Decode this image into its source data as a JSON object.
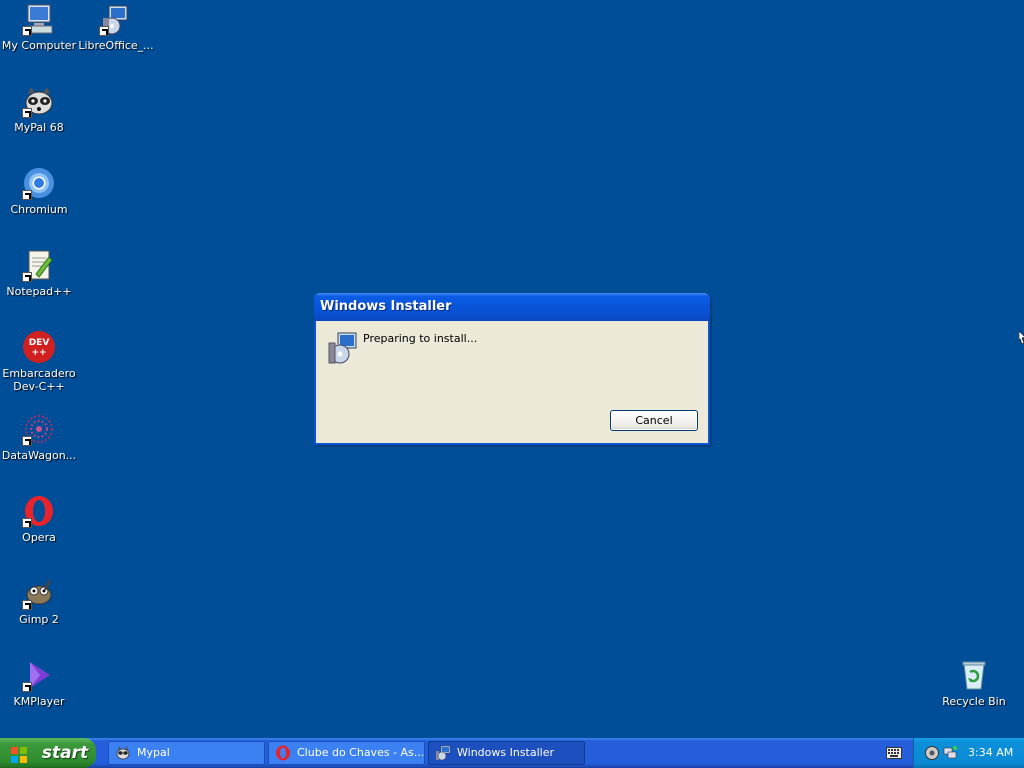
{
  "desktop": {
    "icons": [
      {
        "label": "My Computer",
        "icon": "computer-icon"
      },
      {
        "label": "LibreOffice_...",
        "icon": "installer-icon"
      },
      {
        "label": "MyPal 68",
        "icon": "raccoon-icon"
      },
      {
        "label": "Chromium",
        "icon": "chromium-icon"
      },
      {
        "label": "Notepad++",
        "icon": "notepad-icon"
      },
      {
        "label": "Embarcadero\nDev-C++",
        "icon": "devcpp-icon"
      },
      {
        "label": "DataWagon...",
        "icon": "datawagon-icon"
      },
      {
        "label": "Opera",
        "icon": "opera-icon"
      },
      {
        "label": "Gimp 2",
        "icon": "gimp-icon"
      },
      {
        "label": "KMPlayer",
        "icon": "kmplayer-icon"
      },
      {
        "label": "Recycle Bin",
        "icon": "recycle-bin-icon"
      }
    ]
  },
  "dialog": {
    "title": "Windows Installer",
    "message": "Preparing to install...",
    "cancel_label": "Cancel"
  },
  "taskbar": {
    "start_label": "start",
    "items": [
      {
        "label": "Mypal",
        "icon": "raccoon-icon"
      },
      {
        "label": "Clube do Chaves - As...",
        "icon": "opera-icon"
      },
      {
        "label": "Windows Installer",
        "icon": "installer-icon"
      }
    ],
    "clock": "3:34 AM"
  },
  "colors": {
    "desktop": "#004e98",
    "titlebar": "#0853d6",
    "start": "#3c9a3c",
    "taskbar": "#245edb",
    "tray": "#0b8ad4"
  }
}
